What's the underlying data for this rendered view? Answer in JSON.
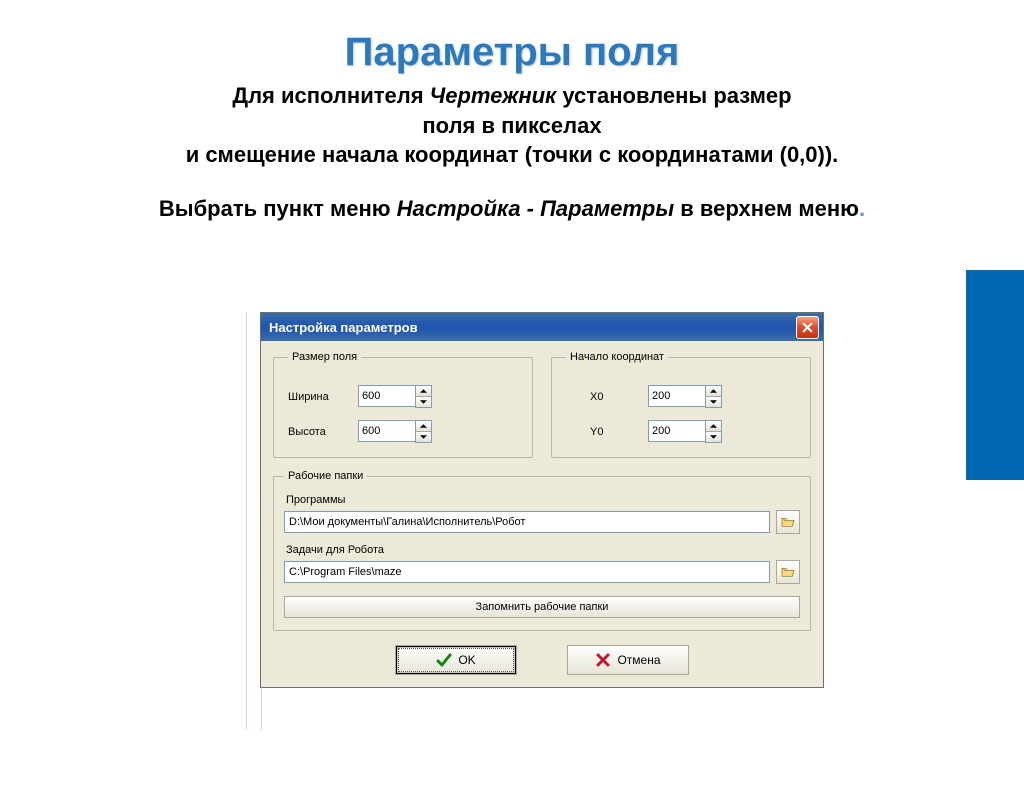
{
  "slide": {
    "title": "Параметры поля",
    "line1_pre": "Для исполнителя ",
    "line1_em": "Чертежник",
    "line1_post": "  установлены размер",
    "line2": "поля в пикселах",
    "line3": "и смещение начала координат (точки с координатами (0,0)).",
    "line4_pre": "Выбрать пункт меню ",
    "line4_em": "Настройка - Параметры",
    "line4_post": " в верхнем меню"
  },
  "dialog": {
    "title": "Настройка параметров",
    "field_size_legend": "Размер поля",
    "width_label": "Ширина",
    "height_label": "Высота",
    "width_value": "600",
    "height_value": "600",
    "origin_legend": "Начало координат",
    "x0_label": "X0",
    "y0_label": "Y0",
    "x0_value": "200",
    "y0_value": "200",
    "folders_legend": "Рабочие папки",
    "programs_label": "Программы",
    "programs_path": "D:\\Мои документы\\Галина\\Исполнитель\\Робот",
    "tasks_label": "Задачи для Робота",
    "tasks_path": "C:\\Program Files\\maze",
    "remember_label": "Запомнить рабочие папки",
    "ok_label": "OK",
    "cancel_label": "Отмена"
  }
}
